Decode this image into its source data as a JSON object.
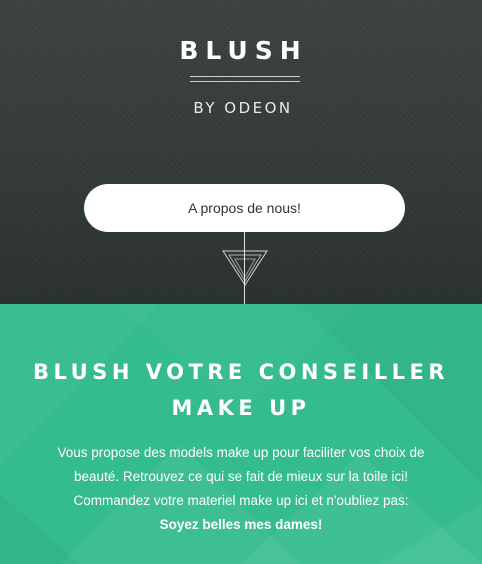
{
  "hero": {
    "title": "BLUSH",
    "subtitle": "BY ODEON",
    "about_button_label": "A propos de nous!"
  },
  "info": {
    "title_line1": "BLUSH VOTRE CONSEILLER",
    "title_line2": "MAKE UP",
    "paragraph_line1": "Vous propose des models make up pour faciliter vos choix de",
    "paragraph_line2": "beauté. Retrouvez ce qui se fait de mieux sur la toile ici!",
    "paragraph_line3": "Commandez votre materiel make up ici et n'oubliez pas:",
    "emphasis": "Soyez belles mes dames!"
  },
  "icons": {
    "connector_arrow": "triangle-down-arrow-icon"
  },
  "colors": {
    "hero_bg": "#3a403e",
    "accent_green": "#34bb8f",
    "text_light": "#ffffff",
    "button_text": "#333333"
  }
}
